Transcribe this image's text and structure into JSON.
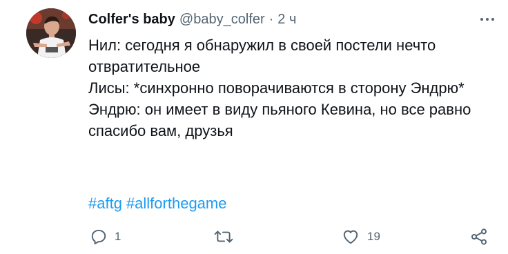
{
  "tweet": {
    "display_name": "Colfer's baby",
    "handle": "@baby_colfer",
    "separator": "·",
    "time": "2 ч",
    "lines": [
      "Нил: сегодня я обнаружил в своей постели нечто отвратительное",
      "Лисы: *синхронно поворачиваются в сторону Эндрю*",
      "Эндрю: он имеет в виду пьяного Кевина, но все равно спасибо вам, друзья"
    ],
    "hashtags": [
      "#aftg",
      "#allforthegame"
    ]
  },
  "actions": {
    "reply": {
      "icon": "reply-icon",
      "count": "1"
    },
    "retweet": {
      "icon": "retweet-icon",
      "count": ""
    },
    "like": {
      "icon": "heart-icon",
      "count": "19"
    },
    "share": {
      "icon": "share-icon"
    }
  },
  "more": {
    "icon": "more-options-icon"
  },
  "colors": {
    "text": "#0f1419",
    "secondary": "#536471",
    "link": "#1d9bf0"
  }
}
